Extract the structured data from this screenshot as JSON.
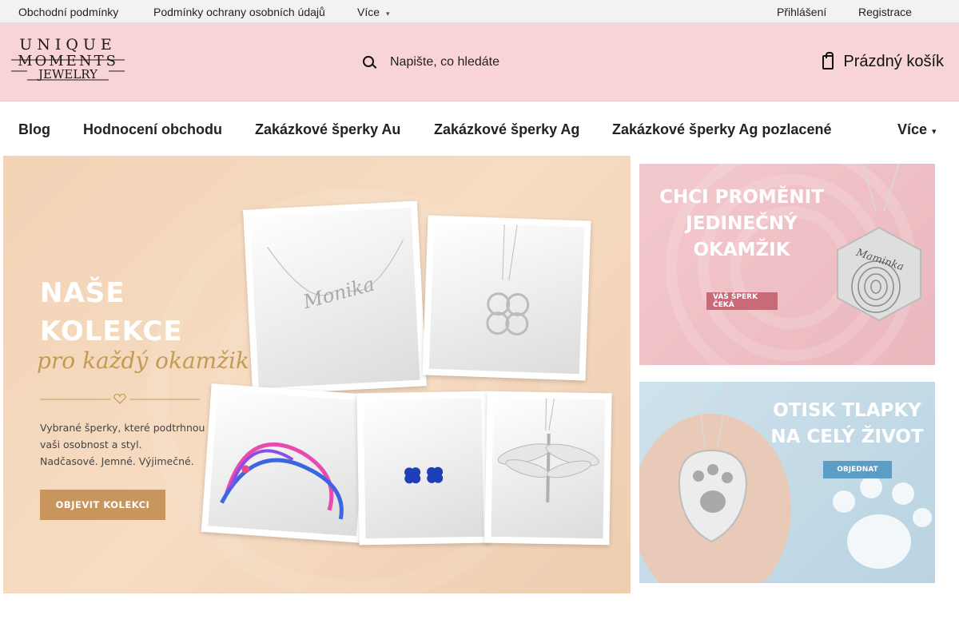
{
  "topbar": {
    "terms": "Obchodní podmínky",
    "privacy": "Podmínky ochrany osobních údajů",
    "more": "Více",
    "login": "Přihlášení",
    "register": "Registrace"
  },
  "header": {
    "logo_lines": [
      "UNIQUE",
      "MOMENTS",
      "JEWELRY"
    ],
    "search_placeholder": "Napište, co hledáte",
    "cart_label": "Prázdný košík"
  },
  "nav": {
    "items": [
      "Blog",
      "Hodnocení obchodu",
      "Zakázkové šperky Au",
      "Zakázkové šperky Ag",
      "Zakázkové šperky Ag pozlacené"
    ],
    "more": "Více"
  },
  "hero": {
    "title_line1": "NAŠE",
    "title_line2": "KOLEKCE",
    "script": "pro každý okamžik",
    "text_line1": "Vybrané šperky, které podtrhnou",
    "text_line2": "vaši osobnost a styl.",
    "text_line3": "Nadčasové. Jemné. Výjimečné.",
    "button": "OBJEVIT KOLEKCI",
    "pendant_name": "Monika"
  },
  "banner1": {
    "line1": "CHCI PROMĚNIT",
    "line2": "JEDINEČNÝ",
    "line3": "OKAMŽIK",
    "button": "VÁŠ ŠPERK ČEKÁ",
    "engraving": "Maminka"
  },
  "banner2": {
    "line1": "OTISK TLAPKY",
    "line2": "NA CELÝ ŽIVOT",
    "button": "OBJEDNAT"
  },
  "colors": {
    "header_bg": "#f9d4d6",
    "hero_btn": "#c8955c",
    "banner1_btn": "#c86a78",
    "banner2_btn": "#5b9dc4"
  }
}
